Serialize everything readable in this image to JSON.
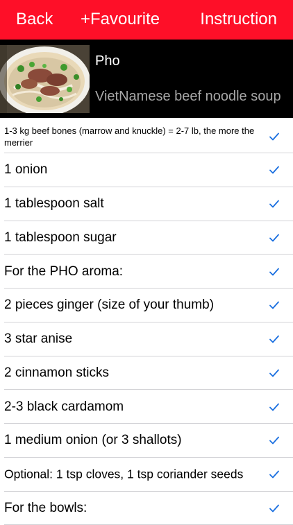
{
  "navbar": {
    "back_label": "Back",
    "favourite_label": "+Favourite",
    "instruction_label": "Instruction",
    "background_color": "#fe0f28"
  },
  "recipe": {
    "title": "Pho",
    "subtitle": "VietNamese beef noodle soup"
  },
  "ingredients": [
    {
      "text": "1-3 kg beef bones (marrow and knuckle) = 2-7 lb, the more the merrier",
      "checked": true
    },
    {
      "text": "1 onion",
      "checked": true
    },
    {
      "text": "1 tablespoon salt",
      "checked": true
    },
    {
      "text": "1 tablespoon sugar",
      "checked": true
    },
    {
      "text": "For the PHO aroma:",
      "checked": true
    },
    {
      "text": "2 pieces ginger (size of your thumb)",
      "checked": true
    },
    {
      "text": "3 star anise",
      "checked": true
    },
    {
      "text": "2 cinnamon sticks",
      "checked": true
    },
    {
      "text": "2-3 black cardamom",
      "checked": true
    },
    {
      "text": "1 medium onion (or 3 shallots)",
      "checked": true
    },
    {
      "text": "Optional: 1 tsp cloves, 1 tsp coriander seeds",
      "checked": true
    },
    {
      "text": "For the bowls:",
      "checked": true
    }
  ],
  "check_icon": "checkmark-icon",
  "check_color": "#1a6fe0"
}
